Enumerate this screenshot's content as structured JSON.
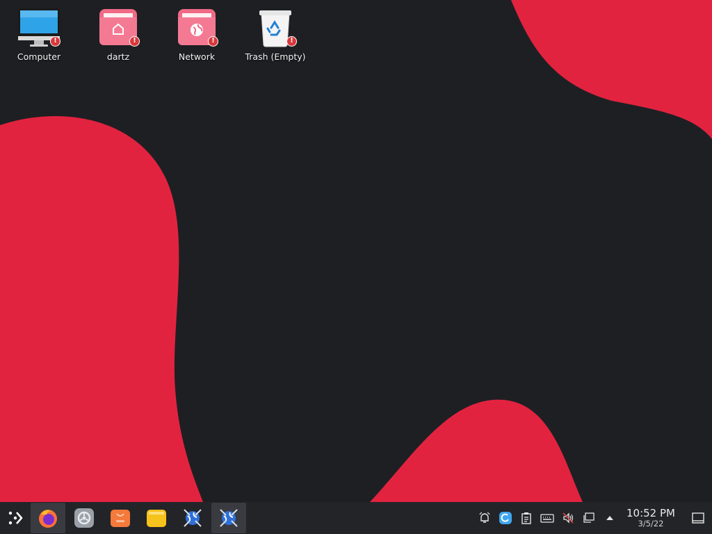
{
  "desktop": {
    "icons": [
      {
        "label": "Computer",
        "icon": "computer-icon"
      },
      {
        "label": "dartz",
        "icon": "home-folder-icon"
      },
      {
        "label": "Network",
        "icon": "network-folder-icon"
      },
      {
        "label": "Trash (Empty)",
        "icon": "trash-icon"
      }
    ],
    "badge_glyph": "!"
  },
  "taskbar": {
    "launcher_icon": "app-launcher-icon",
    "tasks": [
      {
        "icon": "firefox-icon",
        "active": true
      },
      {
        "icon": "system-settings-icon",
        "active": false
      },
      {
        "icon": "software-store-icon",
        "active": false
      },
      {
        "icon": "file-manager-icon",
        "active": false
      },
      {
        "icon": "kde-connect-globe-icon",
        "active": false
      },
      {
        "icon": "kde-connect-globe-icon",
        "active": true
      }
    ],
    "tray": [
      "notifications-icon",
      "app-updates-icon",
      "clipboard-icon",
      "keyboard-icon",
      "volume-muted-icon",
      "network-icon",
      "expand-tray-icon"
    ],
    "clock": {
      "time": "10:52 PM",
      "date": "3/5/22"
    },
    "show_desktop_icon": "show-desktop-icon"
  },
  "colors": {
    "background": "#1e1f23",
    "accent_red": "#e2233f",
    "panel": "#232428",
    "folder_pink": "#f06a86"
  }
}
